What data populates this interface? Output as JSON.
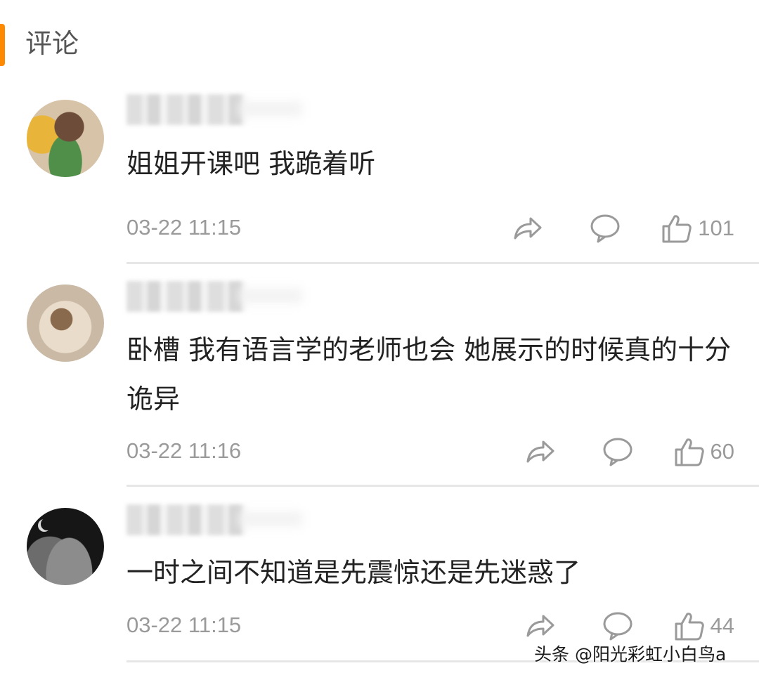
{
  "header": {
    "title": "评论"
  },
  "comments": [
    {
      "text": "姐姐开课吧 我跪着听",
      "time": "03-22 11:15",
      "likes": "101"
    },
    {
      "text": "卧槽 我有语言学的老师也会 她展示的时候真的十分诡异",
      "time": "03-22 11:16",
      "likes": "60"
    },
    {
      "text": "一时之间不知道是先震惊还是先迷惑了",
      "time": "03-22 11:15",
      "likes": "44"
    }
  ],
  "icons": {
    "share": "share-arrow-icon",
    "reply": "comment-bubble-icon",
    "like": "thumbs-up-icon"
  },
  "colors": {
    "accent": "#ff8a00",
    "meta": "#9a9a9a",
    "text": "#222222"
  },
  "watermark": "头条 @阳光彩虹小白鸟a"
}
